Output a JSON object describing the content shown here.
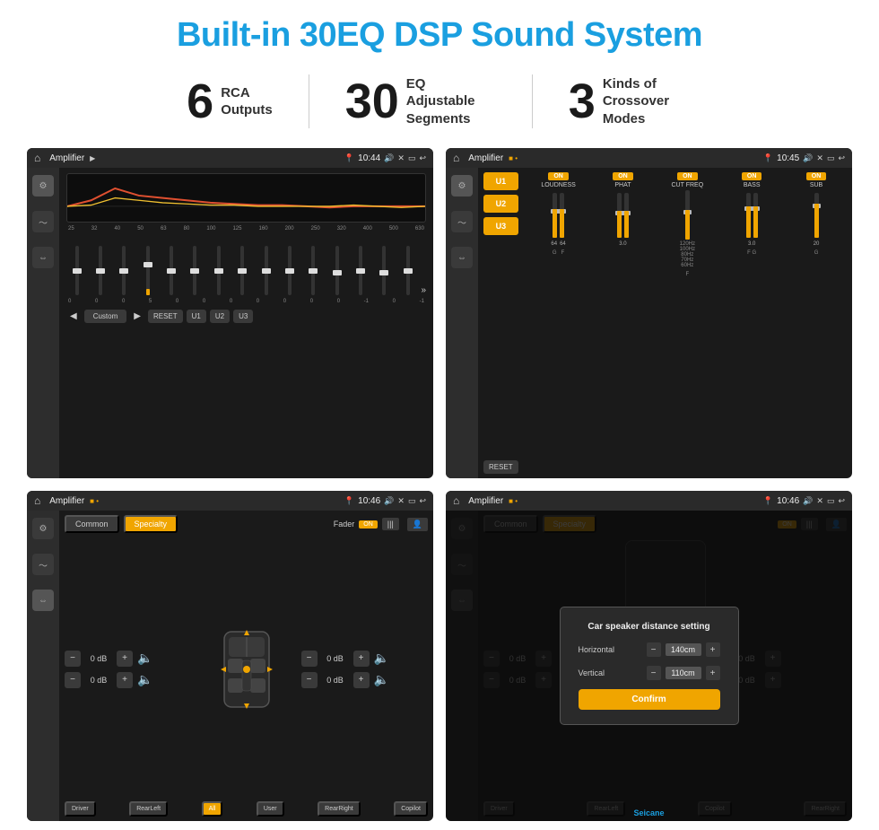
{
  "header": {
    "title": "Built-in 30EQ DSP Sound System"
  },
  "stats": [
    {
      "number": "6",
      "text": "RCA\nOutputs"
    },
    {
      "number": "30",
      "text": "EQ Adjustable\nSegments"
    },
    {
      "number": "3",
      "text": "Kinds of\nCrossover Modes"
    }
  ],
  "screens": {
    "eq": {
      "app_name": "Amplifier",
      "time": "10:44",
      "freq_labels": [
        "25",
        "32",
        "40",
        "50",
        "63",
        "80",
        "100",
        "125",
        "160",
        "200",
        "250",
        "320",
        "400",
        "500",
        "630"
      ],
      "slider_values": [
        "0",
        "0",
        "0",
        "5",
        "0",
        "0",
        "0",
        "0",
        "0",
        "0",
        "0",
        "-1",
        "0",
        "-1"
      ],
      "buttons": [
        "Custom",
        "RESET",
        "U1",
        "U2",
        "U3"
      ]
    },
    "amp": {
      "app_name": "Amplifier",
      "time": "10:45",
      "presets": [
        "U1",
        "U2",
        "U3"
      ],
      "modules": [
        {
          "label": "LOUDNESS",
          "toggle": "ON"
        },
        {
          "label": "PHAT",
          "toggle": "ON"
        },
        {
          "label": "CUT FREQ",
          "toggle": "ON"
        },
        {
          "label": "BASS",
          "toggle": "ON"
        },
        {
          "label": "SUB",
          "toggle": "ON"
        }
      ],
      "reset_btn": "RESET"
    },
    "fader": {
      "app_name": "Amplifier",
      "time": "10:46",
      "tabs": [
        "Common",
        "Specialty"
      ],
      "fader_label": "Fader",
      "on_label": "ON",
      "db_values": [
        "0 dB",
        "0 dB",
        "0 dB",
        "0 dB"
      ],
      "bottom_btns": [
        "Driver",
        "RearLeft",
        "All",
        "User",
        "RearRight",
        "Copilot"
      ]
    },
    "dialog": {
      "app_name": "Amplifier",
      "time": "10:46",
      "dialog_title": "Car speaker distance setting",
      "horizontal_label": "Horizontal",
      "horizontal_value": "140cm",
      "vertical_label": "Vertical",
      "vertical_value": "110cm",
      "confirm_label": "Confirm",
      "bottom_btns": [
        "Driver",
        "RearLeft",
        "Copilot",
        "RearRight"
      ]
    }
  },
  "watermark": "Seicane"
}
